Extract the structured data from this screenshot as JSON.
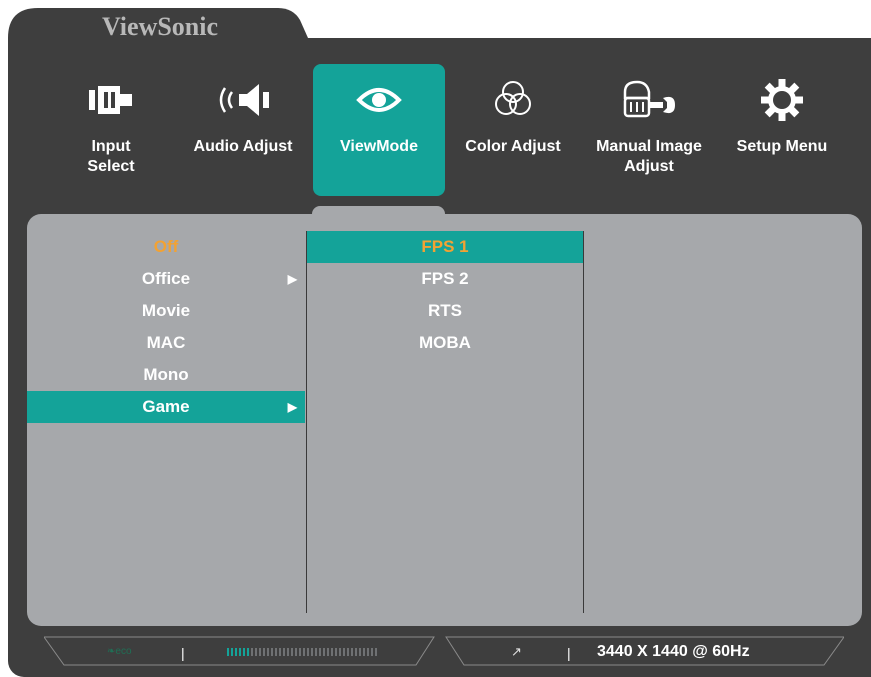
{
  "brand": "ViewSonic",
  "menu": [
    {
      "label": "Input\nSelect",
      "icon": "input-select-icon",
      "active": false
    },
    {
      "label": "Audio Adjust",
      "icon": "audio-adjust-icon",
      "active": false
    },
    {
      "label": "ViewMode",
      "icon": "eye-icon",
      "active": true
    },
    {
      "label": "Color Adjust",
      "icon": "color-adjust-icon",
      "active": false
    },
    {
      "label": "Manual Image\nAdjust",
      "icon": "manual-image-adjust-icon",
      "active": false
    },
    {
      "label": "Setup Menu",
      "icon": "gear-icon",
      "active": false
    }
  ],
  "viewmode_list": [
    {
      "label": "Off",
      "highlighted": true,
      "selected": false,
      "has_submenu": false
    },
    {
      "label": "Office",
      "highlighted": false,
      "selected": false,
      "has_submenu": true
    },
    {
      "label": "Movie",
      "highlighted": false,
      "selected": false,
      "has_submenu": false
    },
    {
      "label": "MAC",
      "highlighted": false,
      "selected": false,
      "has_submenu": false
    },
    {
      "label": "Mono",
      "highlighted": false,
      "selected": false,
      "has_submenu": false
    },
    {
      "label": "Game",
      "highlighted": false,
      "selected": true,
      "has_submenu": true
    }
  ],
  "game_list": [
    {
      "label": "FPS 1",
      "selected": true
    },
    {
      "label": "FPS 2",
      "selected": false
    },
    {
      "label": "RTS",
      "selected": false
    },
    {
      "label": "MOBA",
      "selected": false
    }
  ],
  "status": {
    "eco_label": "eco",
    "eco_level": 0.15,
    "separator": "|",
    "resolution": "3440 X 1440 @ 60Hz"
  },
  "colors": {
    "accent": "#14a399",
    "highlight": "#f2a233",
    "panel": "#a6a8ab",
    "frame": "#3e3e3e"
  }
}
